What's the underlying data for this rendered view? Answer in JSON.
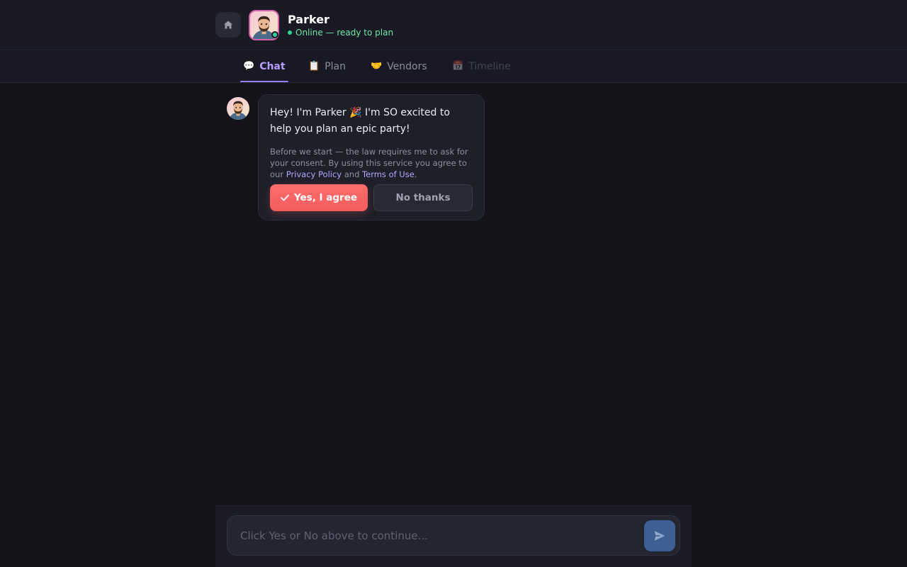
{
  "header": {
    "name": "Parker",
    "status": "Online — ready to plan"
  },
  "tabs": [
    {
      "icon": "💬",
      "label": "Chat",
      "state": "active"
    },
    {
      "icon": "📋",
      "label": "Plan",
      "state": "normal"
    },
    {
      "icon": "🤝",
      "label": "Vendors",
      "state": "normal"
    },
    {
      "icon": "📅",
      "label": "Timeline",
      "state": "disabled"
    }
  ],
  "message": {
    "greeting": "Hey! I'm Parker 🎉 I'm SO excited to help you plan an epic party!",
    "consent_prefix": "Before we start — the law requires me to ask for your consent. By using this service you agree to our ",
    "privacy_link": "Privacy Policy",
    "consent_and": " and ",
    "terms_link": "Terms of Use",
    "consent_suffix": ".",
    "yes_label": "Yes, I agree",
    "no_label": "No thanks"
  },
  "composer": {
    "placeholder": "Click Yes or No above to continue..."
  },
  "colors": {
    "accent": "#9b7bff",
    "primary_button": "#f25c5c",
    "online": "#34d399",
    "send_button": "#3e5f93"
  }
}
